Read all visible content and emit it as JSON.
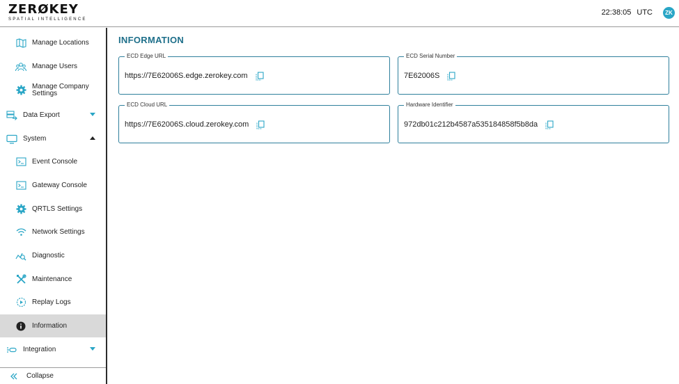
{
  "header": {
    "logo_main": "ZERØKEY",
    "logo_sub": "SPATIAL INTELLIGENCE",
    "time": "22:38:05",
    "timezone": "UTC",
    "avatar_initials": "ZK"
  },
  "sidebar": {
    "items": [
      {
        "label": "Manage Locations",
        "icon": "map-icon"
      },
      {
        "label": "Manage Users",
        "icon": "users-icon"
      },
      {
        "label": "Manage Company Settings",
        "icon": "gear-icon"
      },
      {
        "label": "Data Export",
        "icon": "export-icon"
      },
      {
        "label": "System",
        "icon": "monitor-icon"
      },
      {
        "label": "Event Console",
        "icon": "terminal-icon"
      },
      {
        "label": "Gateway Console",
        "icon": "terminal-icon"
      },
      {
        "label": "QRTLS Settings",
        "icon": "gear-icon"
      },
      {
        "label": "Network Settings",
        "icon": "wifi-icon"
      },
      {
        "label": "Diagnostic",
        "icon": "diagnostic-icon"
      },
      {
        "label": "Maintenance",
        "icon": "tools-icon"
      },
      {
        "label": "Replay Logs",
        "icon": "replay-icon"
      },
      {
        "label": "Information",
        "icon": "info-icon"
      },
      {
        "label": "Integration",
        "icon": "integration-icon"
      }
    ],
    "collapse_label": "Collapse"
  },
  "main": {
    "title": "INFORMATION",
    "fields": {
      "edge_url": {
        "label": "ECD Edge URL",
        "value": "https://7E62006S.edge.zerokey.com"
      },
      "serial": {
        "label": "ECD Serial Number",
        "value": "7E62006S"
      },
      "cloud_url": {
        "label": "ECD Cloud URL",
        "value": "https://7E62006S.cloud.zerokey.com"
      },
      "hardware_id": {
        "label": "Hardware Identifier",
        "value": "972db01c212b4587a535184858f5b8da"
      }
    }
  },
  "colors": {
    "accent": "#2aa6c6",
    "title": "#1e6f8a",
    "active_bg": "#d9d9d9"
  }
}
